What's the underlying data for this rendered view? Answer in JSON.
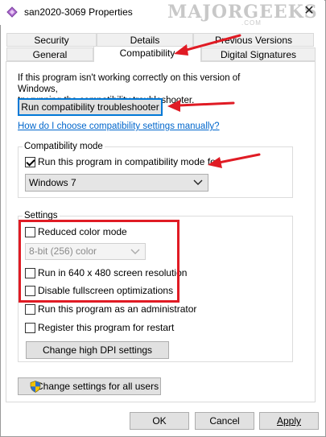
{
  "window": {
    "title": "san2020-3069 Properties",
    "close_glyph": "✕"
  },
  "watermark": {
    "text": "MAJORGEEKS",
    "sub": ".COM"
  },
  "tabs": {
    "row1": [
      "Security",
      "Details",
      "Previous Versions"
    ],
    "row2": [
      "General",
      "Compatibility",
      "Digital Signatures"
    ],
    "active": "Compatibility"
  },
  "intro": {
    "line1": "If this program isn't working correctly on this version of Windows,",
    "line2": "try running the compatibility troubleshooter."
  },
  "troubleshooter_button": "Run compatibility troubleshooter",
  "help_link": "How do I choose compatibility settings manually?",
  "compat_mode": {
    "group_label": "Compatibility mode",
    "checkbox_label": "Run this program in compatibility mode for:",
    "checked": true,
    "selected_os": "Windows 7"
  },
  "settings": {
    "group_label": "Settings",
    "reduced_color": {
      "label": "Reduced color mode",
      "checked": false
    },
    "color_select": "8-bit (256) color",
    "res_640": {
      "label": "Run in 640 x 480 screen resolution",
      "checked": false
    },
    "disable_fullscreen": {
      "label": "Disable fullscreen optimizations",
      "checked": false
    },
    "run_admin": {
      "label": "Run this program as an administrator",
      "checked": false
    },
    "register_restart": {
      "label": "Register this program for restart",
      "checked": false
    },
    "dpi_button": "Change high DPI settings"
  },
  "all_users_button": "Change settings for all users",
  "footer": {
    "ok": "OK",
    "cancel": "Cancel",
    "apply": "Apply"
  },
  "colors": {
    "annotation_red": "#e01b24",
    "focus_blue": "#0078d7",
    "link_blue": "#0066cc"
  }
}
